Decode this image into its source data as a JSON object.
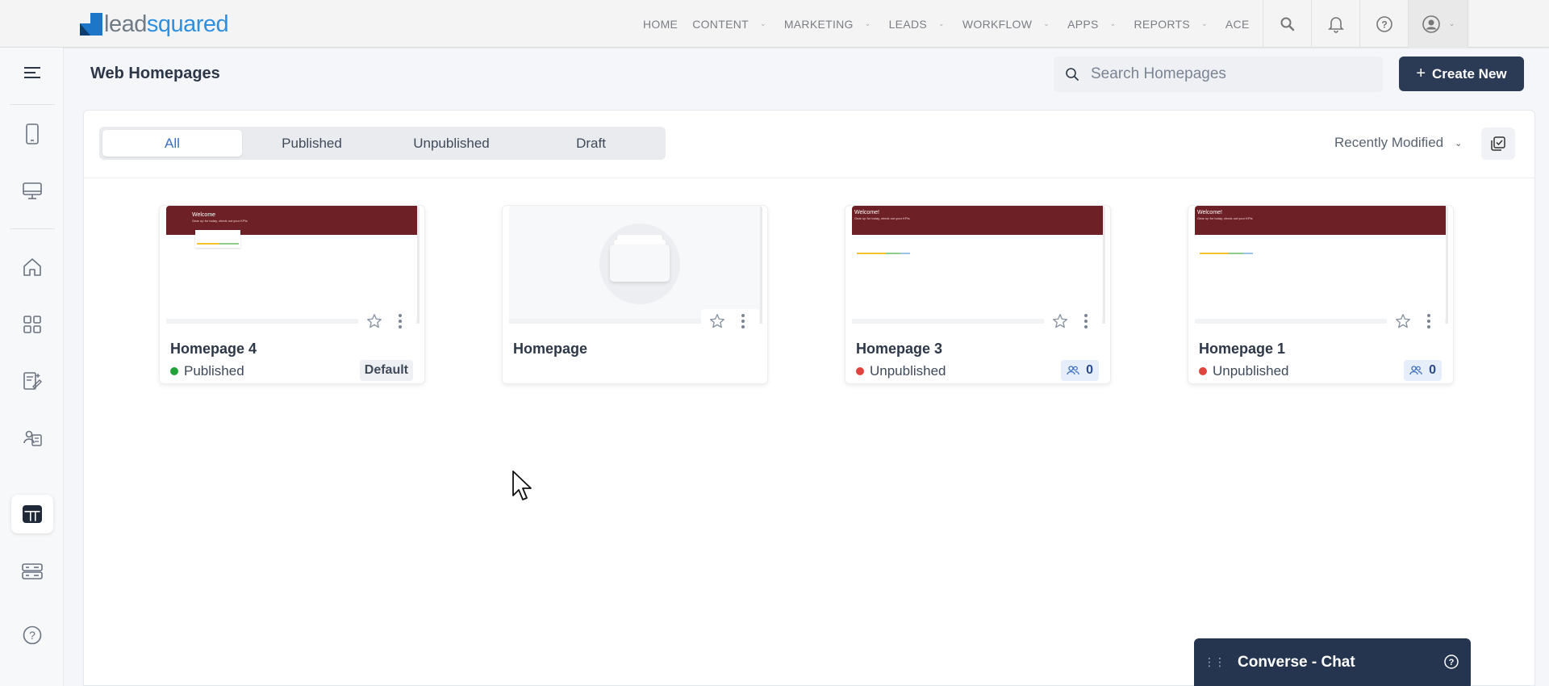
{
  "logo": {
    "part1": "lead",
    "part2": "squared"
  },
  "nav": {
    "items": [
      {
        "label": "HOME",
        "dropdown": false
      },
      {
        "label": "CONTENT",
        "dropdown": true
      },
      {
        "label": "MARKETING",
        "dropdown": true
      },
      {
        "label": "LEADS",
        "dropdown": true
      },
      {
        "label": "WORKFLOW",
        "dropdown": true
      },
      {
        "label": "APPS",
        "dropdown": true
      },
      {
        "label": "REPORTS",
        "dropdown": true
      },
      {
        "label": "ACE",
        "dropdown": false
      }
    ],
    "icons": [
      "search-icon",
      "bell-icon",
      "help-icon",
      "user-profile-icon"
    ]
  },
  "sidebar": {
    "icons": [
      "hamburger-menu-icon",
      "mobile-icon",
      "desktop-icon",
      "home-icon",
      "grid-icon",
      "forms-icon",
      "landing-pages-icon",
      "web-homepages-icon",
      "server-icon",
      "help-icon"
    ],
    "active": "web-homepages-icon"
  },
  "header": {
    "title": "Web Homepages",
    "search_placeholder": "Search Homepages",
    "create_label": "Create New"
  },
  "filters": {
    "tabs": [
      "All",
      "Published",
      "Unpublished",
      "Draft"
    ],
    "active_tab": "All",
    "sort_label": "Recently Modified"
  },
  "cards": [
    {
      "title": "Homepage 4",
      "status": "Published",
      "status_color": "#22a33a",
      "badge": "Default",
      "thumb": "welcome"
    },
    {
      "title": "Homepage",
      "status": "",
      "badge": "",
      "thumb": "empty"
    },
    {
      "title": "Homepage 3",
      "status": "Unpublished",
      "status_color": "#e0443e",
      "count": "0",
      "thumb": "welcome"
    },
    {
      "title": "Homepage 1",
      "status": "Unpublished",
      "status_color": "#e0443e",
      "count": "0",
      "thumb": "welcome"
    }
  ],
  "thumb_text": {
    "welcome_a": "Welcome",
    "welcome_b": "Welcome!",
    "sub": "Gear up for today, check out your KPIs"
  },
  "chat": {
    "label": "Converse - Chat"
  },
  "colors": {
    "brand": "#2b3a55",
    "accent": "#3a6fc4",
    "thumb_band": "#6d2026"
  }
}
